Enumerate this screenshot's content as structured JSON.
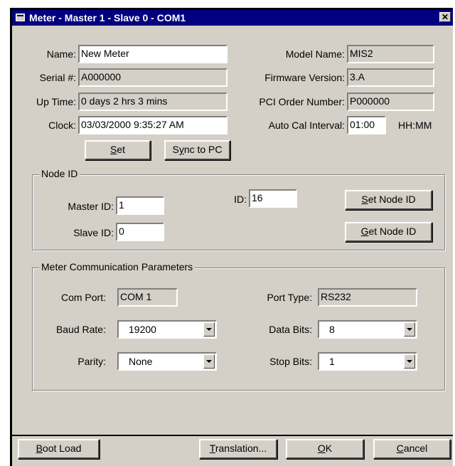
{
  "window": {
    "title": "Meter - Master 1 - Slave 0 - COM1"
  },
  "info": {
    "name_label": "Name:",
    "name_value": "New Meter",
    "serial_label": "Serial #:",
    "serial_value": "A000000",
    "uptime_label": "Up Time:",
    "uptime_value": "0 days 2 hrs 3 mins",
    "clock_label": "Clock:",
    "clock_value": "03/03/2000 9:35:27 AM",
    "model_label": "Model Name:",
    "model_value": "MIS2",
    "firmware_label": "Firmware Version:",
    "firmware_value": "3.A",
    "pci_label": "PCI Order Number:",
    "pci_value": "P000000",
    "autocal_label": "Auto Cal Interval:",
    "autocal_value": "01:00",
    "autocal_unit": "HH:MM"
  },
  "buttons": {
    "set_key": "S",
    "set_rest": "et",
    "sync_pre": "S",
    "sync_key": "y",
    "sync_rest": "nc to PC"
  },
  "node": {
    "group_title": "Node ID",
    "master_label": "Master ID:",
    "master_value": "1",
    "slave_label": "Slave ID:",
    "slave_value": "0",
    "id_label": "ID:",
    "id_value": "16",
    "set_node_key": "S",
    "set_node_rest": "et Node ID",
    "get_node_key": "G",
    "get_node_rest": "et Node ID"
  },
  "comm": {
    "group_title": "Meter Communication Parameters",
    "comport_label": "Com Port:",
    "comport_value": "COM 1",
    "porttype_label": "Port Type:",
    "porttype_value": "RS232",
    "baud_label": "Baud Rate:",
    "baud_value": "19200",
    "databits_label": "Data Bits:",
    "databits_value": "8",
    "parity_label": "Parity:",
    "parity_value": "None",
    "stopbits_label": "Stop Bits:",
    "stopbits_value": "1"
  },
  "footer": {
    "boot_key": "B",
    "boot_rest": "oot Load",
    "trans_key": "T",
    "trans_rest": "ranslation...",
    "ok_key": "O",
    "ok_rest": "K",
    "cancel_key": "C",
    "cancel_rest": "ancel"
  }
}
